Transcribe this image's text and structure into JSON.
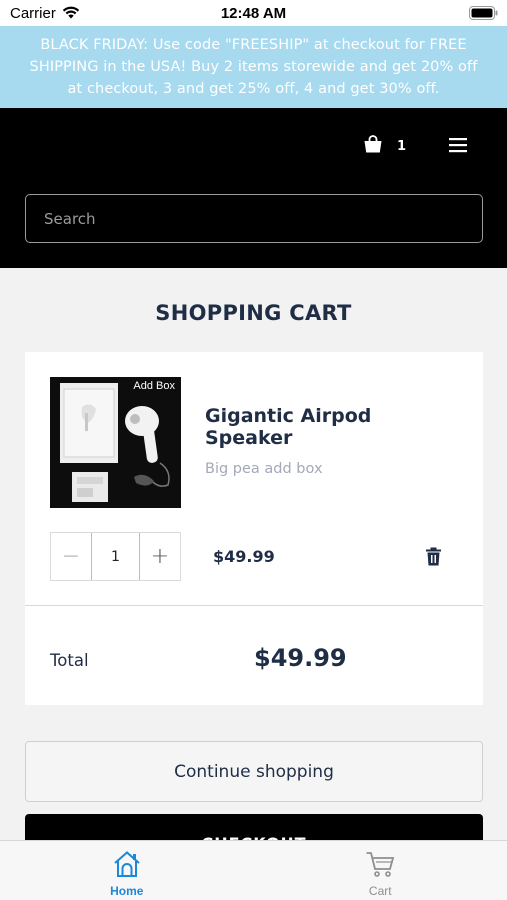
{
  "status_bar": {
    "carrier": "Carrier",
    "time": "12:48 AM"
  },
  "promo": {
    "text": "BLACK FRIDAY: Use code \"FREESHIP\" at checkout for FREE SHIPPING in the USA! Buy 2 items storewide and get 20% off at checkout, 3 and get 25% off, 4 and get 30% off."
  },
  "header": {
    "cart_count": "1",
    "search_placeholder": "Search"
  },
  "page": {
    "title": "SHOPPING CART"
  },
  "cart": {
    "item": {
      "image_caption": "Add Box",
      "name": "Gigantic Airpod Speaker",
      "variant": "Big pea add box",
      "quantity": "1",
      "minus": "−",
      "plus": "+",
      "price": "$49.99"
    },
    "total_label": "Total",
    "total_value": "$49.99"
  },
  "actions": {
    "continue_label": "Continue shopping",
    "checkout_label": "CHECKOUT"
  },
  "tabs": [
    {
      "label": "Home",
      "icon": "home-icon",
      "active": true
    },
    {
      "label": "Cart",
      "icon": "cart-icon",
      "active": false
    }
  ],
  "colors": {
    "promo_bg": "#a7d9ef",
    "header_bg": "#000000",
    "accent": "#1e88d8",
    "text": "#1f2d45"
  }
}
